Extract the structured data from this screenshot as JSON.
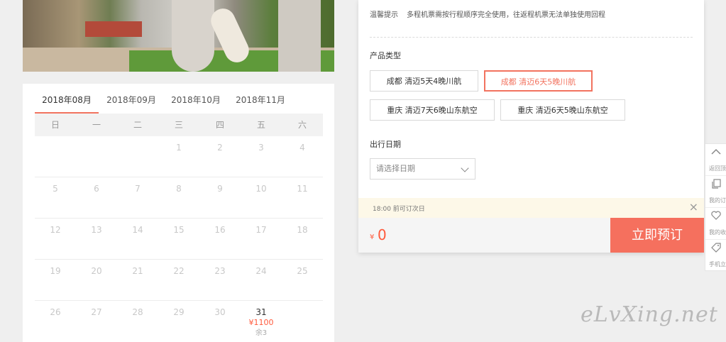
{
  "calendar": {
    "tabs": [
      "2018年08月",
      "2018年09月",
      "2018年10月",
      "2018年11月"
    ],
    "weekdays": [
      "日",
      "一",
      "二",
      "三",
      "四",
      "五",
      "六"
    ],
    "rows": [
      [
        "",
        "",
        "",
        "1",
        "2",
        "3",
        "4"
      ],
      [
        "5",
        "6",
        "7",
        "8",
        "9",
        "10",
        "11"
      ],
      [
        "12",
        "13",
        "14",
        "15",
        "16",
        "17",
        "18"
      ],
      [
        "19",
        "20",
        "21",
        "22",
        "23",
        "24",
        "25"
      ],
      [
        "26",
        "27",
        "28",
        "29",
        "30",
        "31",
        ""
      ]
    ],
    "special": {
      "day": "31",
      "price": "¥1100",
      "stock": "余3"
    }
  },
  "panel": {
    "tip_label": "温馨提示",
    "tip_text": "多程机票需按行程顺序完全使用，往返程机票无法单独使用回程",
    "product_title": "产品类型",
    "products": [
      "成都 清迈5天4晚川航",
      "成都 清迈6天5晚川航",
      "重庆 清迈7天6晚山东航空",
      "重庆 清迈6天5晚山东航空"
    ],
    "selected_product": 1,
    "date_title": "出行日期",
    "date_placeholder": "请选择日期",
    "notice": "18:00 前可订次日",
    "notice_close": "×",
    "currency": "¥",
    "total": "0",
    "book_label": "立即预订"
  },
  "floatbar": {
    "items": [
      {
        "icon": "chevron-up-icon",
        "label": "返回顶"
      },
      {
        "icon": "orders-icon",
        "label": "我的订"
      },
      {
        "icon": "heart-icon",
        "label": "我的收"
      },
      {
        "icon": "tag-icon",
        "label": "手机立"
      }
    ]
  },
  "watermark": "eLvXing.net"
}
